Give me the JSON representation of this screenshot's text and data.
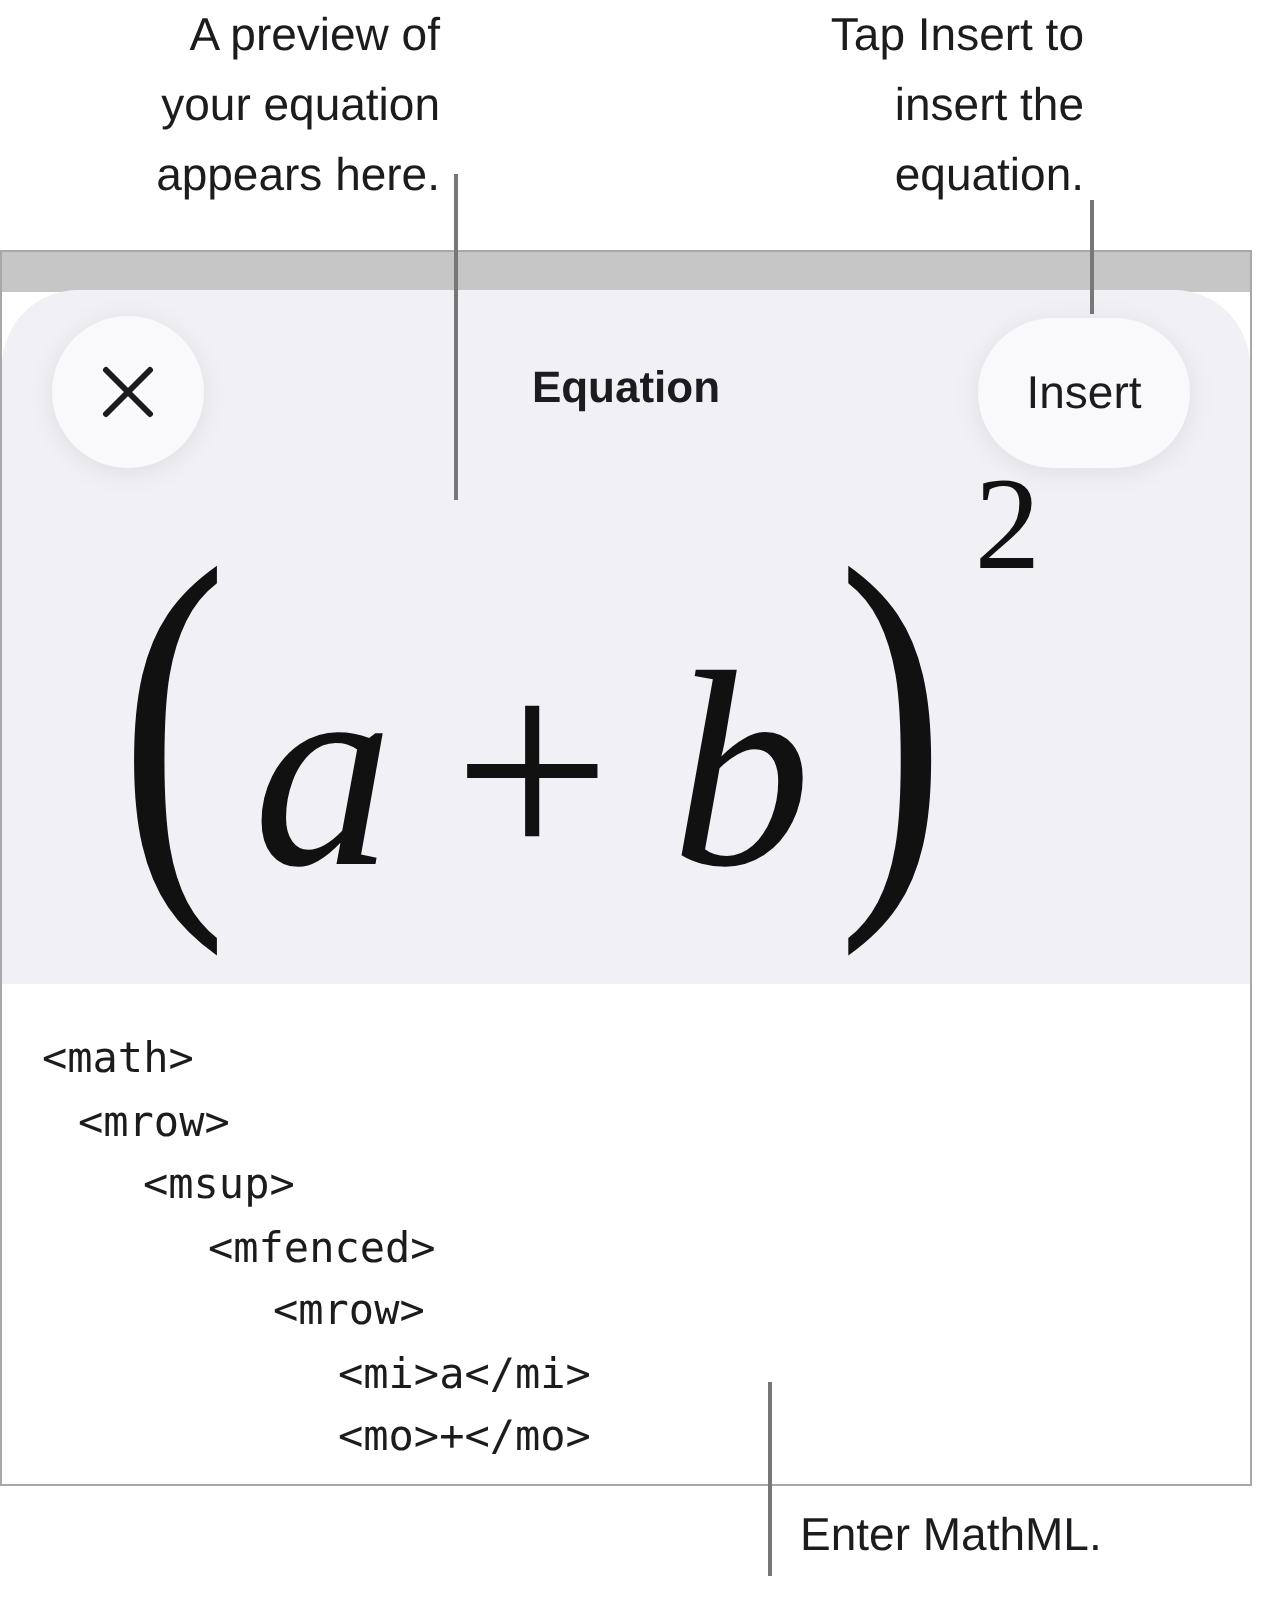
{
  "callouts": {
    "preview": {
      "lines": [
        "A preview of",
        "your equation",
        "appears here."
      ]
    },
    "insert": {
      "lines": [
        "Tap Insert to",
        "insert the",
        "equation."
      ]
    },
    "mathml": {
      "lines": [
        "Enter MathML."
      ]
    }
  },
  "sheet": {
    "title": "Equation",
    "insert_button": {
      "label": "Insert"
    },
    "preview": {
      "parts": [
        {
          "kind": "paren",
          "text": "("
        },
        {
          "kind": "var",
          "text": "a"
        },
        {
          "kind": "op",
          "text": "+"
        },
        {
          "kind": "var",
          "text": "b"
        },
        {
          "kind": "paren",
          "text": ")"
        },
        {
          "kind": "sup",
          "text": "2"
        }
      ]
    },
    "code": [
      {
        "text": "<math>",
        "children": [
          {
            "text": "<mrow>",
            "children": [
              {
                "text": "<msup>",
                "children": [
                  {
                    "text": "<mfenced>",
                    "children": [
                      {
                        "text": "<mrow>",
                        "children": [
                          {
                            "text": "<mi>a</mi>"
                          },
                          {
                            "text": "<mo>+</mo>"
                          }
                        ]
                      }
                    ]
                  }
                ]
              }
            ]
          }
        ]
      }
    ]
  }
}
